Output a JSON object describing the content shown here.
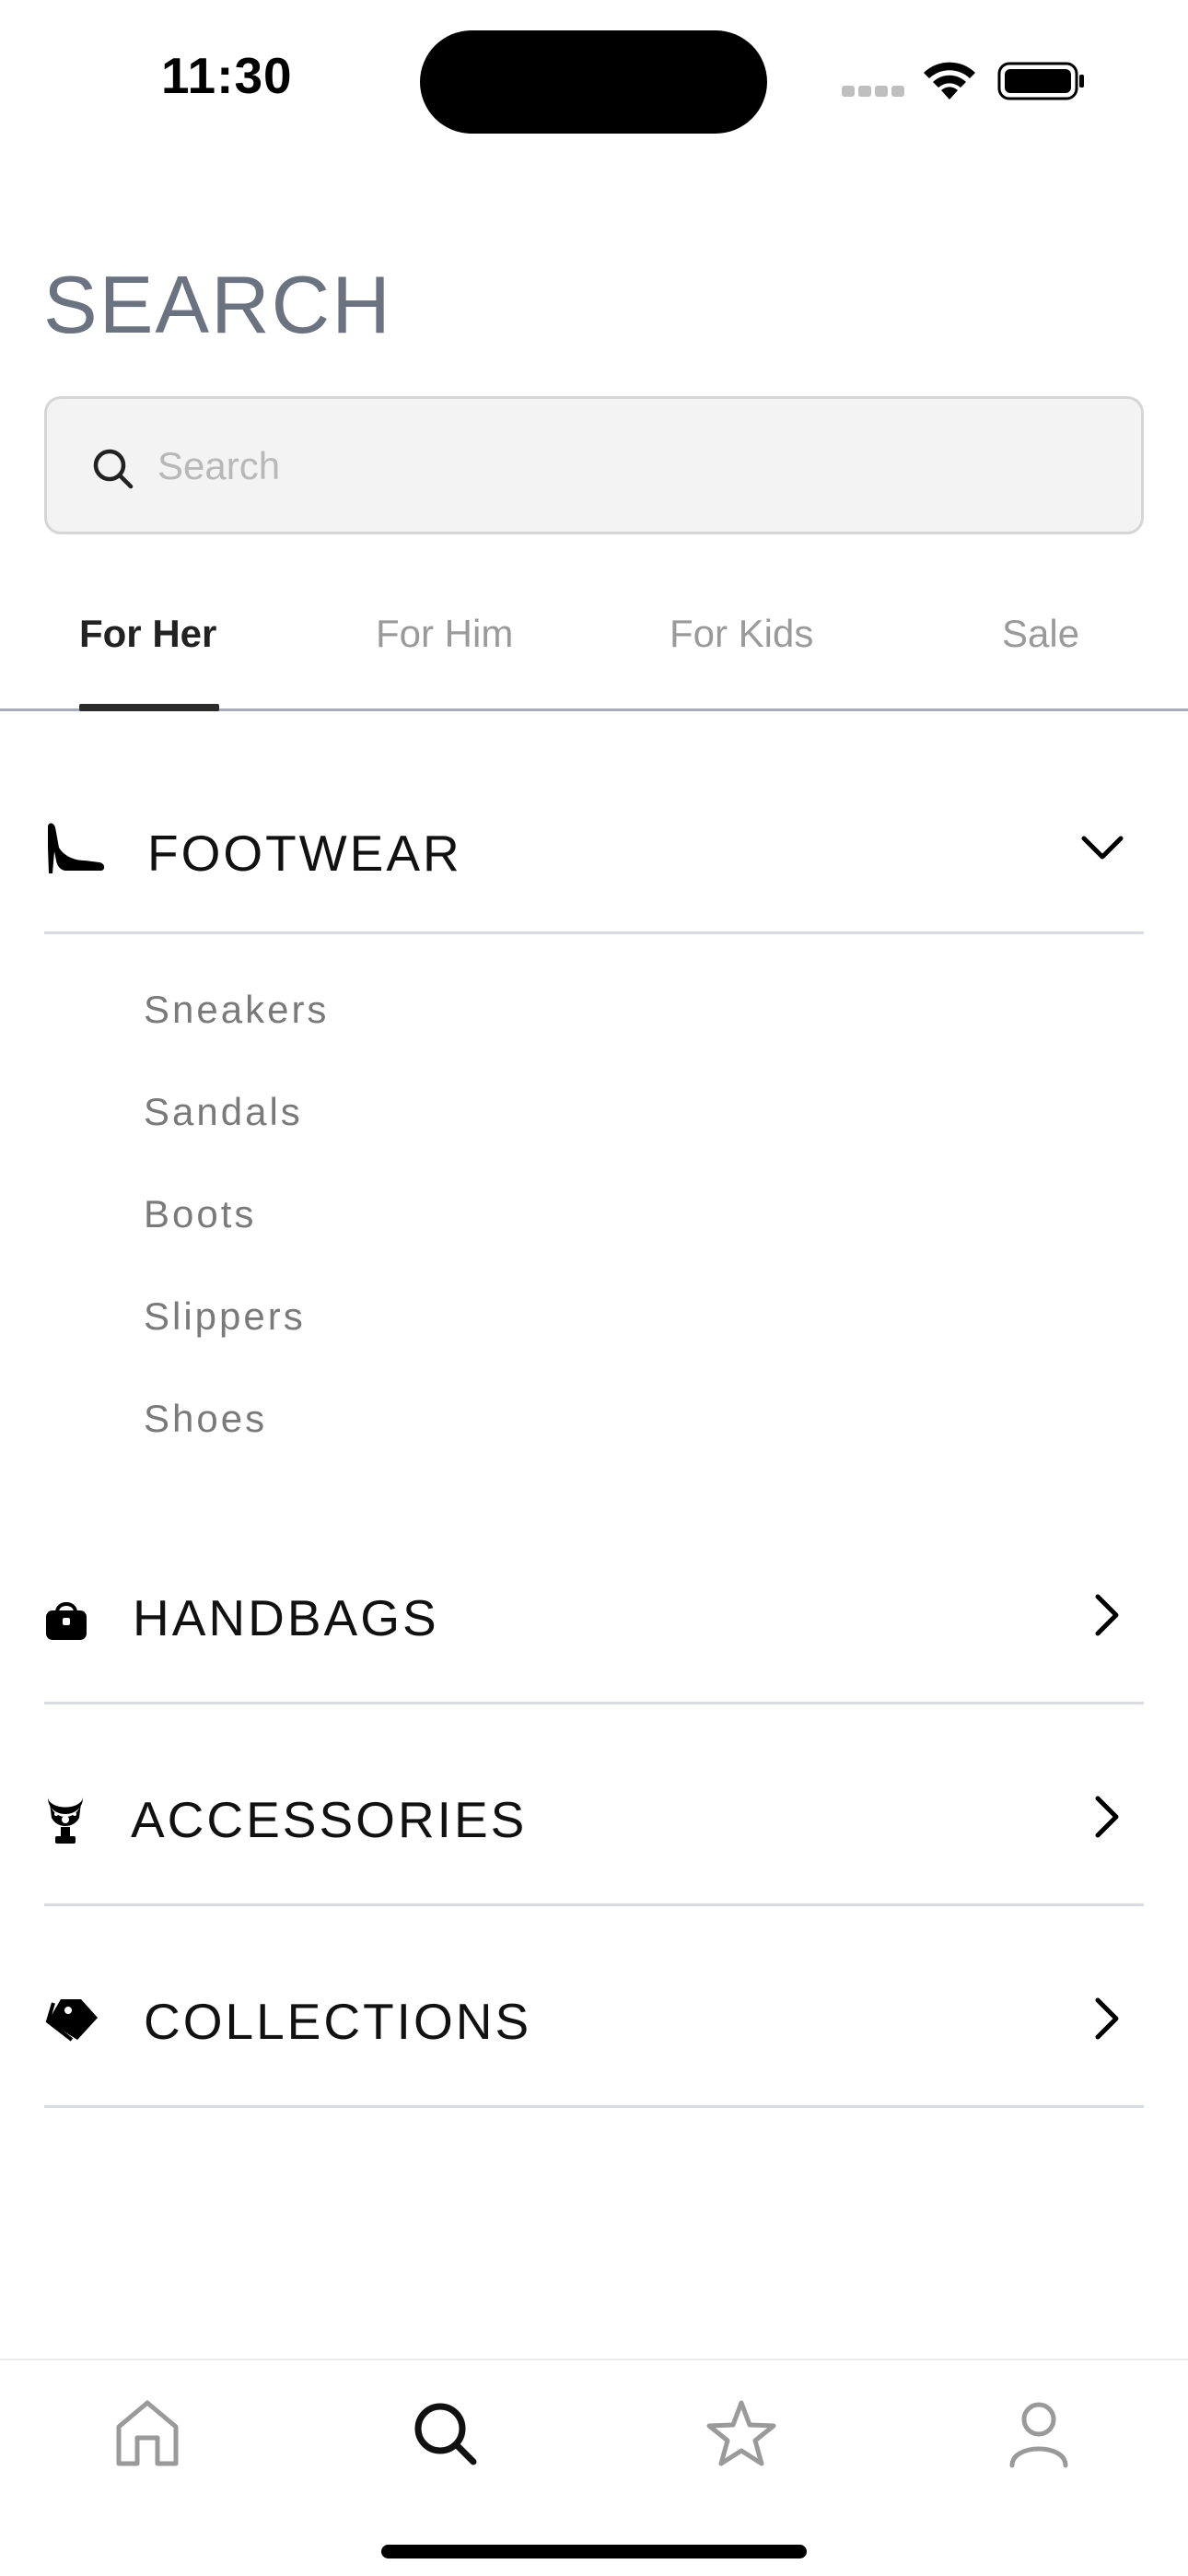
{
  "status_bar": {
    "time": "11:30"
  },
  "page": {
    "title": "SEARCH"
  },
  "search": {
    "placeholder": "Search",
    "value": ""
  },
  "tabs": [
    {
      "label": "For Her",
      "active": true
    },
    {
      "label": "For Him",
      "active": false
    },
    {
      "label": "For Kids",
      "active": false
    },
    {
      "label": "Sale",
      "active": false
    }
  ],
  "categories": [
    {
      "label": "FOOTWEAR",
      "icon": "high-heel-icon",
      "expanded": true,
      "subitems": [
        "Sneakers",
        "Sandals",
        "Boots",
        "Slippers",
        "Shoes"
      ]
    },
    {
      "label": "HANDBAGS",
      "icon": "handbag-icon",
      "expanded": false
    },
    {
      "label": "ACCESSORIES",
      "icon": "necklace-bust-icon",
      "expanded": false
    },
    {
      "label": "COLLECTIONS",
      "icon": "tags-icon",
      "expanded": false
    }
  ],
  "bottom_nav": [
    {
      "icon": "home-icon",
      "active": false
    },
    {
      "icon": "search-icon",
      "active": true
    },
    {
      "icon": "star-icon",
      "active": false
    },
    {
      "icon": "profile-icon",
      "active": false
    }
  ],
  "colors": {
    "title": "#6b7280",
    "tab_active": "#222222",
    "tab_inactive": "#9a9a9a",
    "divider": "#d8dbe2",
    "subitem": "#7a7a7a",
    "nav_inactive": "#9a9a9a",
    "nav_active": "#111111"
  }
}
